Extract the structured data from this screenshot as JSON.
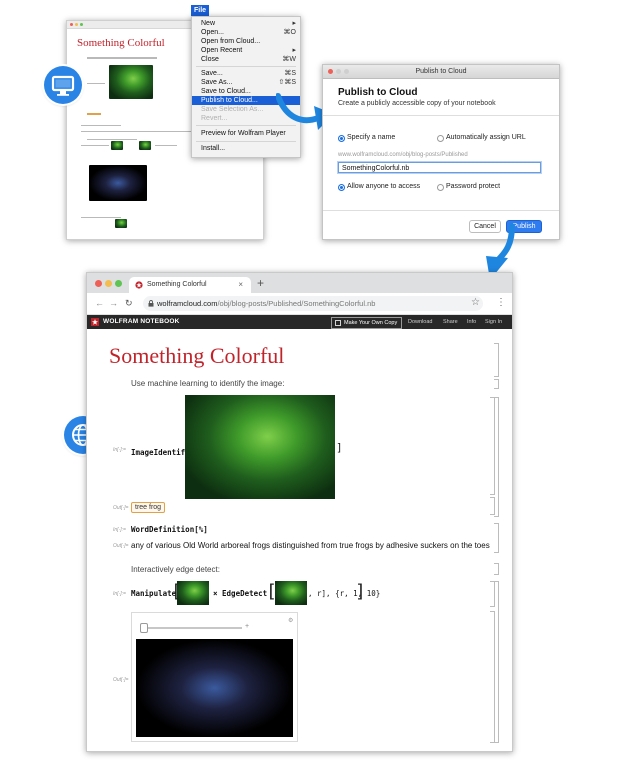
{
  "file_menu": {
    "title": "File",
    "items": [
      {
        "label": "New",
        "shortcut": "▸"
      },
      {
        "label": "Open...",
        "shortcut": "⌘O"
      },
      {
        "label": "Open from Cloud...",
        "shortcut": ""
      },
      {
        "label": "Open Recent",
        "shortcut": "▸"
      },
      {
        "label": "Close",
        "shortcut": "⌘W"
      },
      {
        "label": "Save...",
        "shortcut": "⌘S"
      },
      {
        "label": "Save As...",
        "shortcut": "⇧⌘S"
      },
      {
        "label": "Save to Cloud...",
        "shortcut": ""
      },
      {
        "label": "Publish to Cloud...",
        "shortcut": ""
      },
      {
        "label": "Save Selection As...",
        "shortcut": ""
      },
      {
        "label": "Revert...",
        "shortcut": ""
      },
      {
        "label": "Preview for Wolfram Player",
        "shortcut": ""
      },
      {
        "label": "Install...",
        "shortcut": ""
      }
    ]
  },
  "mini_notebook": {
    "title": "Something Colorful"
  },
  "publish_dialog": {
    "window_title": "Publish to Cloud",
    "heading": "Publish to Cloud",
    "subheading": "Create a publicly accessible copy of your notebook",
    "option_specify": "Specify a name",
    "option_auto": "Automatically assign URL",
    "url_prefix": "www.wolframcloud.com/obj/blog-posts/Published",
    "filename_value": "SomethingColorful.nb",
    "option_allow": "Allow anyone to access",
    "option_password": "Password protect",
    "cancel_label": "Cancel",
    "publish_label": "Publish"
  },
  "browser": {
    "tab_title": "Something Colorful",
    "tab_close": "×",
    "new_tab": "+",
    "url_domain": "wolframcloud.com",
    "url_path": "/obj/blog-posts/Published/SomethingColorful.nb"
  },
  "wolfram_bar": {
    "brand": "WOLFRAM NOTEBOOK",
    "make_copy": "Make Your Own Copy",
    "download": "Download",
    "share": "Share",
    "info": "Info",
    "sign_in": "Sign In"
  },
  "notebook": {
    "title": "Something Colorful",
    "text1": "Use machine learning to identify the image:",
    "in1_label": "In[·]:=",
    "in1_code": "ImageIdentify",
    "out1_label": "Out[·]=",
    "out1_chip": "tree frog",
    "in2_label": "In[·]:=",
    "in2_code": "WordDefinition[%]",
    "out2_label": "Out[·]=",
    "out2_text": "any of various Old World arboreal frogs distinguished from true frogs by adhesive suckers on the toes",
    "text2": "Interactively edge detect:",
    "in3_label": "In[·]:=",
    "in3_code_a": "Manipulate",
    "in3_code_b": "× EdgeDetect",
    "in3_code_c": ", r], {r, 1, 10}",
    "out3_label": "Out[·]="
  },
  "colors": {
    "accent_blue": "#2a84e6",
    "wolfram_red": "#c1232b",
    "menu_highlight": "#1a5fd6"
  },
  "icons": [
    "desktop-monitor-icon",
    "globe-icon",
    "arrow-icon",
    "wolfram-logo-icon",
    "back-icon",
    "forward-icon",
    "reload-icon",
    "lock-icon",
    "star-icon",
    "more-icon"
  ]
}
